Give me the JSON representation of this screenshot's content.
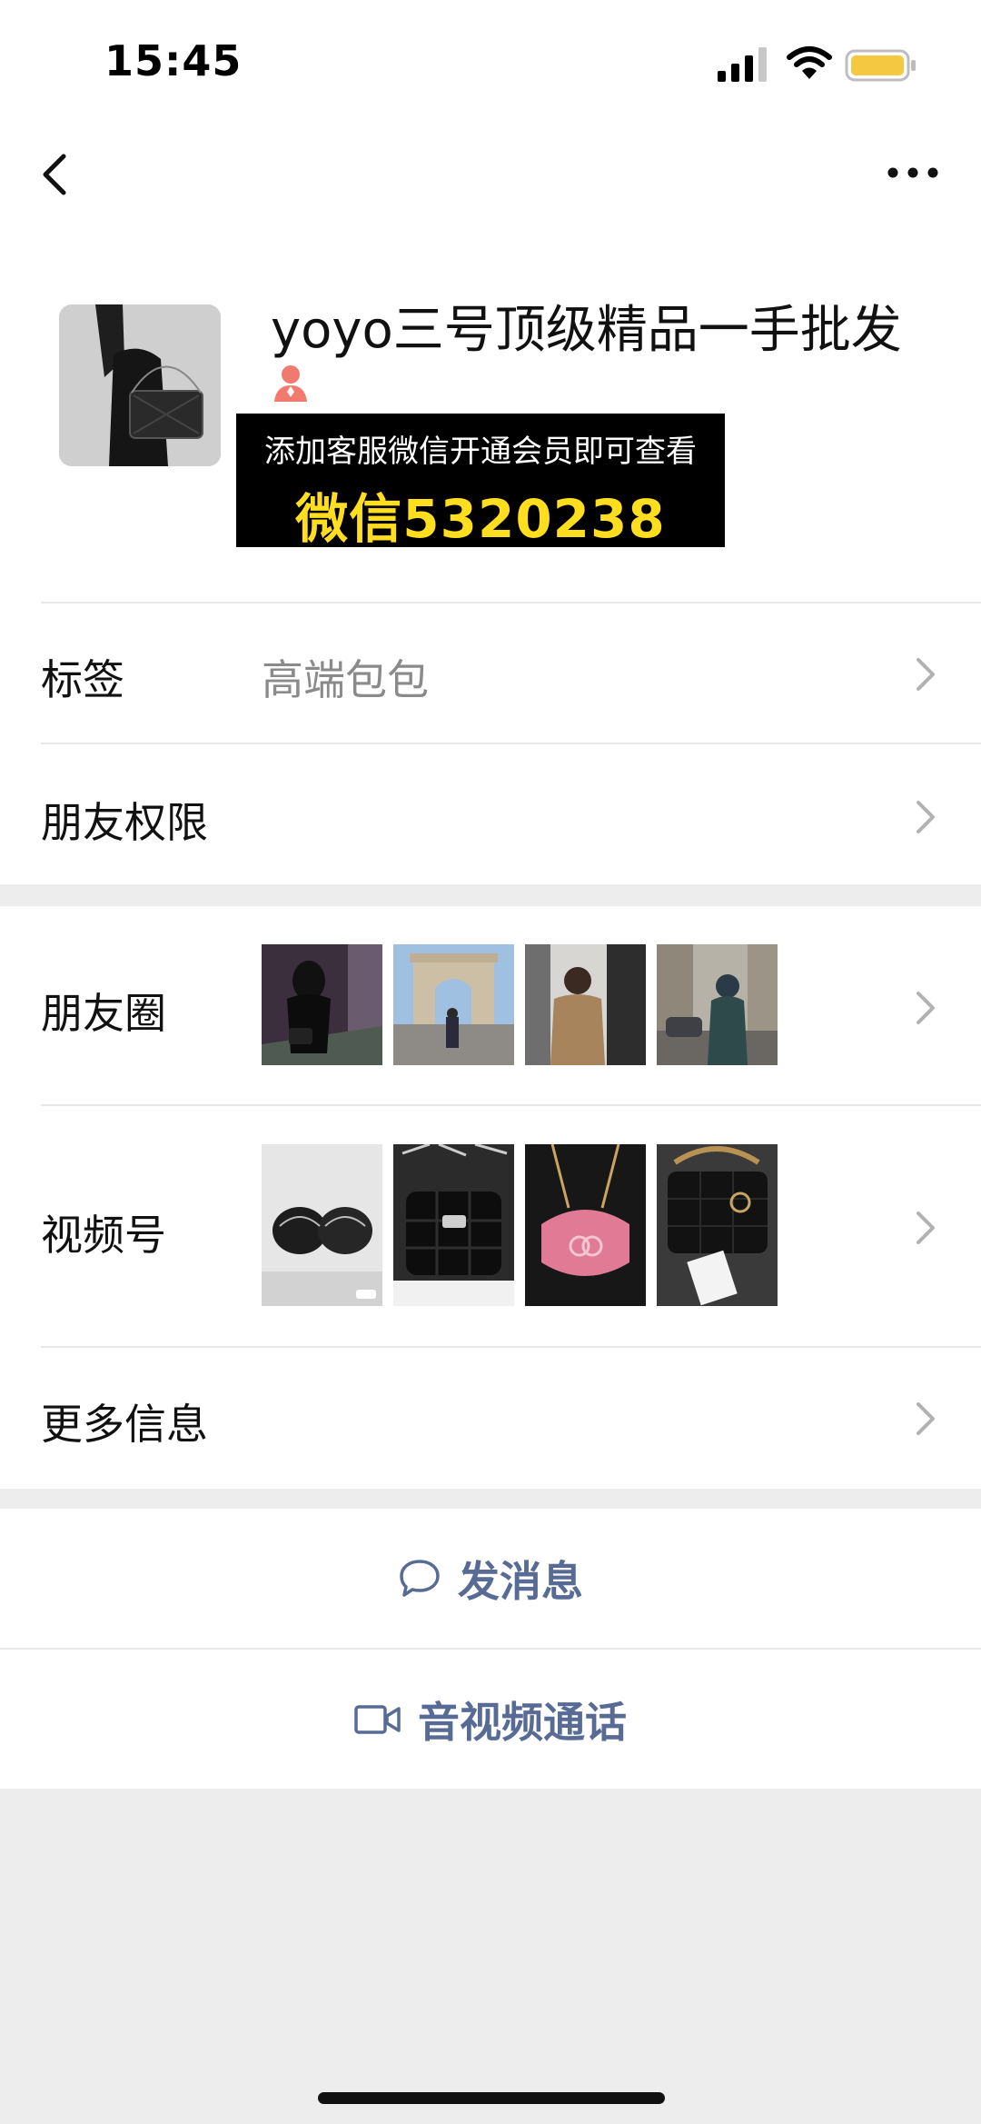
{
  "status_bar": {
    "time": "15:45",
    "signal_icon": "cellular-signal-icon",
    "wifi_icon": "wifi-icon",
    "battery_icon": "battery-icon",
    "battery_color": "#f5c842"
  },
  "nav": {
    "back_icon": "chevron-left-icon",
    "more_icon": "more-dots-icon"
  },
  "profile": {
    "name": "yoyo三号顶级精品一手批发",
    "gender_icon": "female-person-icon",
    "promo": {
      "line1": "添加客服微信开通会员即可查看",
      "line2": "微信5320238"
    }
  },
  "rows": {
    "tags": {
      "label": "标签",
      "value": "高端包包"
    },
    "friend_permissions": {
      "label": "朋友权限"
    },
    "moments": {
      "label": "朋友圈",
      "thumbnails": [
        "photo-woman-night-bag",
        "photo-arc-de-triomphe",
        "photo-woman-tan-coat",
        "photo-woman-paris-street"
      ]
    },
    "channels": {
      "label": "视频号",
      "thumbnails": [
        "video-black-bags-gift",
        "video-black-flap-bag",
        "video-pink-round-bag",
        "video-black-chain-bag"
      ]
    },
    "more_info": {
      "label": "更多信息"
    }
  },
  "actions": {
    "message": {
      "label": "发消息",
      "icon": "chat-bubble-icon"
    },
    "call": {
      "label": "音视频通话",
      "icon": "video-camera-icon"
    }
  },
  "colors": {
    "link": "#576b95",
    "promo_highlight": "#ffdd1f",
    "background": "#ededed"
  }
}
